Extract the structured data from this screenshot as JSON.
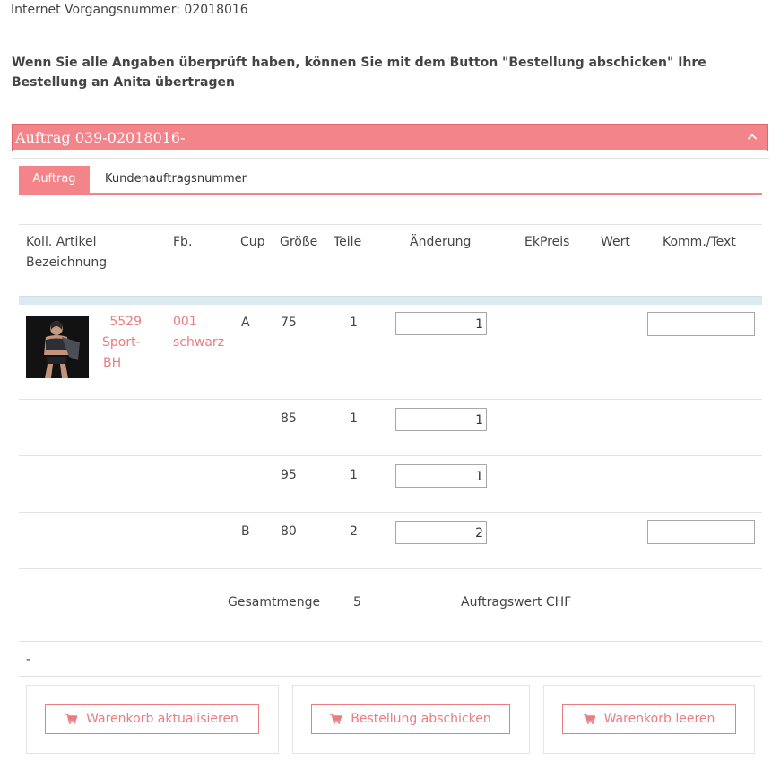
{
  "header": {
    "vorgang": "Internet Vorgangsnummer: 02018016",
    "notice": "Wenn Sie alle Angaben überprüft haben, können Sie mit dem Button \"Bestellung abschicken\" Ihre Bestellung an Anita übertragen"
  },
  "panel": {
    "title": "Auftrag 039-02018016-"
  },
  "tabs": [
    {
      "label": "Auftrag",
      "active": true
    },
    {
      "label": "Kundenauftragsnummer",
      "active": false
    }
  ],
  "table": {
    "headers": {
      "artikel": "Koll. Artikel",
      "bezeichnung": "Bezeichnung",
      "fb": "Fb.",
      "cup": "Cup",
      "groesse": "Größe",
      "teile": "Teile",
      "aenderung": "Änderung",
      "ekpreis": "EkPreis",
      "wert": "Wert",
      "komm": "Komm./Text"
    },
    "product": {
      "artikel_nr": "5529",
      "bez1": "Sport-",
      "bez2": "BH",
      "fb_nr": "001",
      "fb_name": "schwarz"
    },
    "rows": [
      {
        "cup": "A",
        "groesse": "75",
        "teile": "1",
        "aenderung": "1"
      },
      {
        "cup": "",
        "groesse": "85",
        "teile": "1",
        "aenderung": "1"
      },
      {
        "cup": "",
        "groesse": "95",
        "teile": "1",
        "aenderung": "1"
      },
      {
        "cup": "B",
        "groesse": "80",
        "teile": "2",
        "aenderung": "2"
      }
    ],
    "summary": {
      "gesamtmenge_label": "Gesamtmenge",
      "gesamtmenge": "5",
      "auftragswert_label": "Auftragswert CHF"
    },
    "footer_text": "-"
  },
  "buttons": {
    "update": "Warenkorb aktualisieren",
    "submit": "Bestellung abschicken",
    "clear": "Warenkorb leeren"
  },
  "icons": {
    "cart": "shopping-cart-icon",
    "chevron": "chevron-up-icon"
  },
  "colors": {
    "accent": "#f2848a",
    "link": "#ea7c82"
  }
}
